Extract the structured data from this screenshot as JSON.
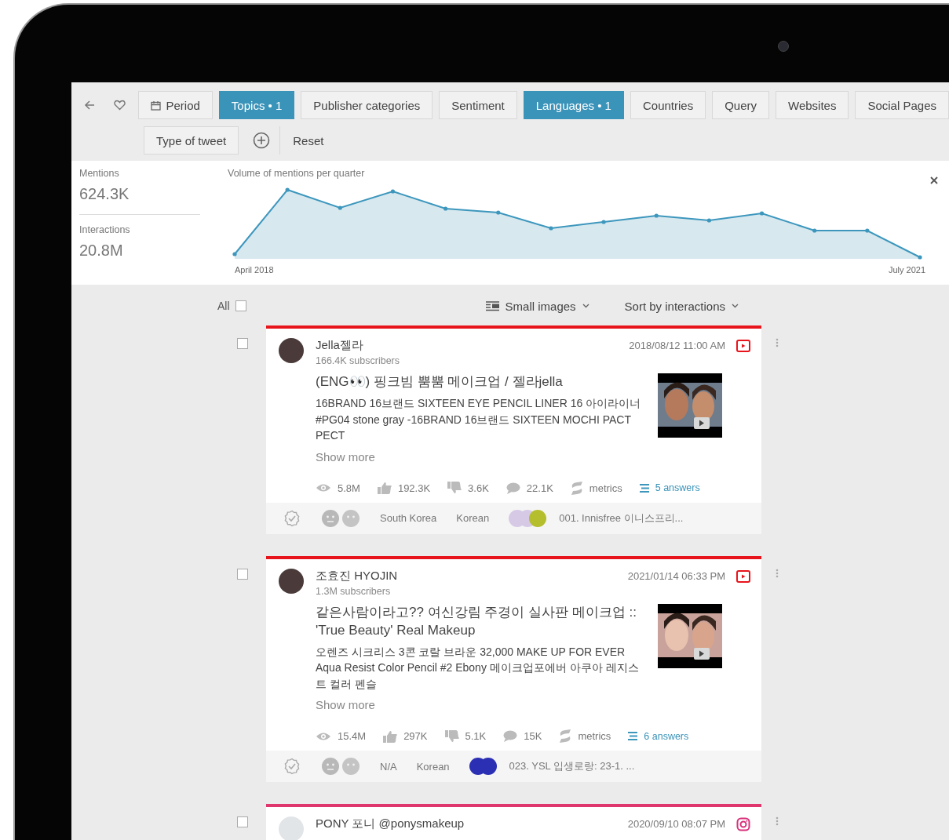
{
  "filters": [
    {
      "label": "Period",
      "selected": false
    },
    {
      "label": "Topics • 1",
      "selected": true
    },
    {
      "label": "Publisher categories",
      "selected": false
    },
    {
      "label": "Sentiment",
      "selected": false
    },
    {
      "label": "Languages • 1",
      "selected": true
    },
    {
      "label": "Countries",
      "selected": false
    },
    {
      "label": "Query",
      "selected": false
    },
    {
      "label": "Websites",
      "selected": false
    },
    {
      "label": "Social Pages",
      "selected": false
    },
    {
      "label": "Type of tweet",
      "selected": false
    }
  ],
  "reset": "Reset",
  "stats": [
    {
      "label": "Mentions",
      "value": "624.3K"
    },
    {
      "label": "Interactions",
      "value": "20.8M"
    }
  ],
  "chart": {
    "title": "Volume of mentions per quarter",
    "start_label": "April 2018",
    "end_label": "July 2021"
  },
  "list_controls": {
    "all": "All",
    "all_checked": false,
    "view": "Small images",
    "sort": "Sort by interactions"
  },
  "posts": [
    {
      "kind": "youtube",
      "checked": false,
      "author": "Jella젤라",
      "followers": "166.4K subscribers",
      "date": "2018/08/12 11:00 AM",
      "title": "(ENG👀) 핑크빔 뿜뿜 메이크업 / 젤라jella",
      "text": "16BRAND 16브랜드 SIXTEEN EYE PENCIL LINER 16 아이라이너 #PG04 stone gray -16BRAND 16브랜드 SIXTEEN MOCHI PACT PECT",
      "show_more": "Show more",
      "stats": [
        {
          "kind": "views",
          "value": "5.8M"
        },
        {
          "kind": "likes",
          "value": "192.3K"
        },
        {
          "kind": "dislikes",
          "value": "3.6K"
        },
        {
          "kind": "comments",
          "value": "22.1K"
        },
        {
          "kind": "metrics",
          "value": "metrics"
        }
      ],
      "answers": "5 answers",
      "country": "South Korea",
      "language": "Korean",
      "topics": [
        {
          "color": "#d6c9e6"
        },
        {
          "color": "#d6c9e6"
        },
        {
          "color": "#b5be2c"
        }
      ],
      "topic": "001. Innisfree 이니스프리..."
    },
    {
      "kind": "youtube",
      "checked": false,
      "author": "조효진 HYOJIN",
      "followers": "1.3M subscribers",
      "date": "2021/01/14 06:33 PM",
      "title": "같은사람이라고?? 여신강림 주경이 실사판 메이크업 :: 'True Beauty' Real Makeup",
      "text": "오렌즈 시크리스 3콘 코랄 브라운 32,000 MAKE UP FOR EVER Aqua Resist Color Pencil #2 Ebony 메이크업포에버 아쿠아 레지스트 컬러 펜슬",
      "show_more": "Show more",
      "stats": [
        {
          "kind": "views",
          "value": "15.4M"
        },
        {
          "kind": "likes",
          "value": "297K"
        },
        {
          "kind": "dislikes",
          "value": "5.1K"
        },
        {
          "kind": "comments",
          "value": "15K"
        },
        {
          "kind": "metrics",
          "value": "metrics"
        }
      ],
      "answers": "6 answers",
      "country": "N/A",
      "language": "Korean",
      "topics": [
        {
          "color": "#2b2fb3"
        },
        {
          "color": "#2b2fb3"
        }
      ],
      "topic": "023. YSL 입생로랑: 23-1. ..."
    },
    {
      "kind": "instagram",
      "checked": false,
      "author": "PONY 포니 @ponysmakeup",
      "date": "2020/09/10 08:07 PM"
    }
  ]
}
